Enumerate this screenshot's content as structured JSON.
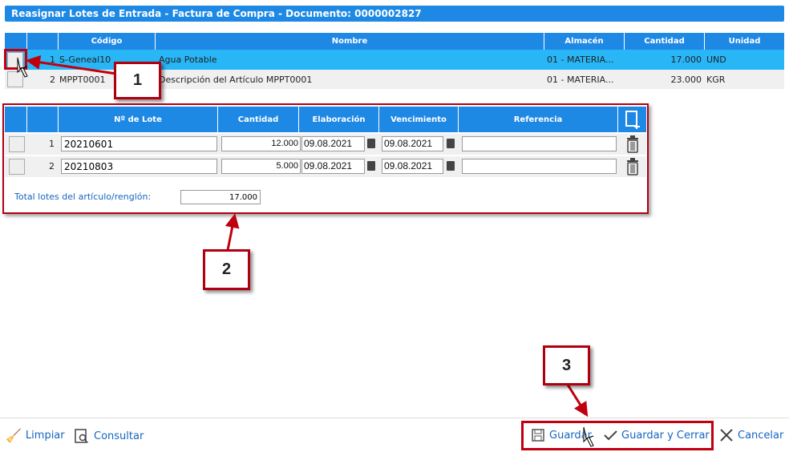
{
  "title": "Reasignar Lotes de Entrada - Factura de Compra - Documento: 0000002827",
  "items_table": {
    "headers": [
      "Código",
      "Nombre",
      "Almacén",
      "Cantidad",
      "Unidad"
    ],
    "rows": [
      {
        "n": "1",
        "codigo": "S-Geneal10",
        "nombre": "Agua Potable",
        "almacen": "01 - MATERIA...",
        "cantidad": "17.000",
        "unidad": "UND"
      },
      {
        "n": "2",
        "codigo": "MPPT0001",
        "nombre": "Descripción del Artículo MPPT0001",
        "almacen": "01 - MATERIA...",
        "cantidad": "23.000",
        "unidad": "KGR"
      }
    ]
  },
  "lots_table": {
    "headers": [
      "Nº de Lote",
      "Cantidad",
      "Elaboración",
      "Vencimiento",
      "Referencia"
    ],
    "rows": [
      {
        "n": "1",
        "lote": "20210601",
        "cantidad": "12.000",
        "elaboracion": "09.08.2021",
        "vencimiento": "09.08.2021",
        "referencia": ""
      },
      {
        "n": "2",
        "lote": "20210803",
        "cantidad": "5.000",
        "elaboracion": "09.08.2021",
        "vencimiento": "09.08.2021",
        "referencia": ""
      }
    ],
    "total_label": "Total lotes del artículo/renglón:",
    "total_value": "17.000"
  },
  "toolbar": {
    "limpiar": "Limpiar",
    "consultar": "Consultar",
    "guardar": "Guardar",
    "guardar_cerrar": "Guardar y Cerrar",
    "cancelar": "Cancelar"
  },
  "callouts": [
    "1",
    "2",
    "3"
  ]
}
